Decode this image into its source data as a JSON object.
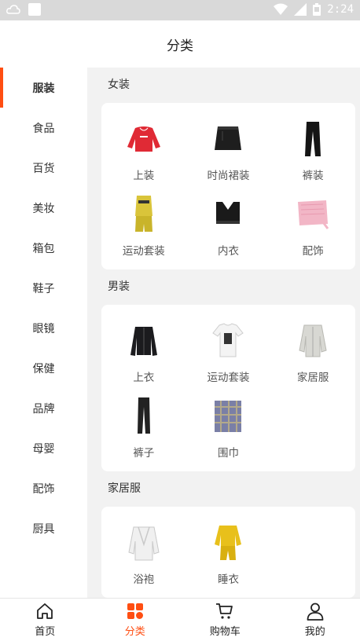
{
  "status_bar": {
    "time": "2:24",
    "icons": [
      "cloud-icon",
      "app-square-icon",
      "wifi-icon",
      "signal-icon",
      "battery-icon"
    ]
  },
  "header": {
    "title": "分类"
  },
  "sidebar": {
    "active_index": 0,
    "items": [
      {
        "label": "服装"
      },
      {
        "label": "食品"
      },
      {
        "label": "百货"
      },
      {
        "label": "美妆"
      },
      {
        "label": "箱包"
      },
      {
        "label": "鞋子"
      },
      {
        "label": "眼镜"
      },
      {
        "label": "保健"
      },
      {
        "label": "品牌"
      },
      {
        "label": "母婴"
      },
      {
        "label": "配饰"
      },
      {
        "label": "厨具"
      }
    ]
  },
  "sections": [
    {
      "title": "女装",
      "items": [
        {
          "label": "上装",
          "icon": "red-hoodie-icon"
        },
        {
          "label": "时尚裙装",
          "icon": "black-skirt-icon"
        },
        {
          "label": "裤装",
          "icon": "black-pants-icon"
        },
        {
          "label": "运动套装",
          "icon": "yellow-sportswear-icon"
        },
        {
          "label": "内衣",
          "icon": "black-bra-icon"
        },
        {
          "label": "配饰",
          "icon": "pink-scarf-icon"
        }
      ]
    },
    {
      "title": "男装",
      "items": [
        {
          "label": "上衣",
          "icon": "black-jacket-icon"
        },
        {
          "label": "运动套装",
          "icon": "white-tshirt-icon"
        },
        {
          "label": "家居服",
          "icon": "grey-pajamas-icon"
        },
        {
          "label": "裤子",
          "icon": "black-trousers-icon"
        },
        {
          "label": "围巾",
          "icon": "plaid-scarf-icon"
        }
      ]
    },
    {
      "title": "家居服",
      "items": [
        {
          "label": "浴袍",
          "icon": "white-bathrobe-icon"
        },
        {
          "label": "睡衣",
          "icon": "yellow-pajamas-icon"
        }
      ]
    }
  ],
  "tabbar": {
    "active_index": 1,
    "tabs": [
      {
        "label": "首页",
        "icon": "home-icon"
      },
      {
        "label": "分类",
        "icon": "category-icon"
      },
      {
        "label": "购物车",
        "icon": "cart-icon"
      },
      {
        "label": "我的",
        "icon": "profile-icon"
      }
    ]
  },
  "colors": {
    "accent": "#ff4e12",
    "background": "#f2f2f2",
    "statusbar": "#d9d9d9"
  }
}
